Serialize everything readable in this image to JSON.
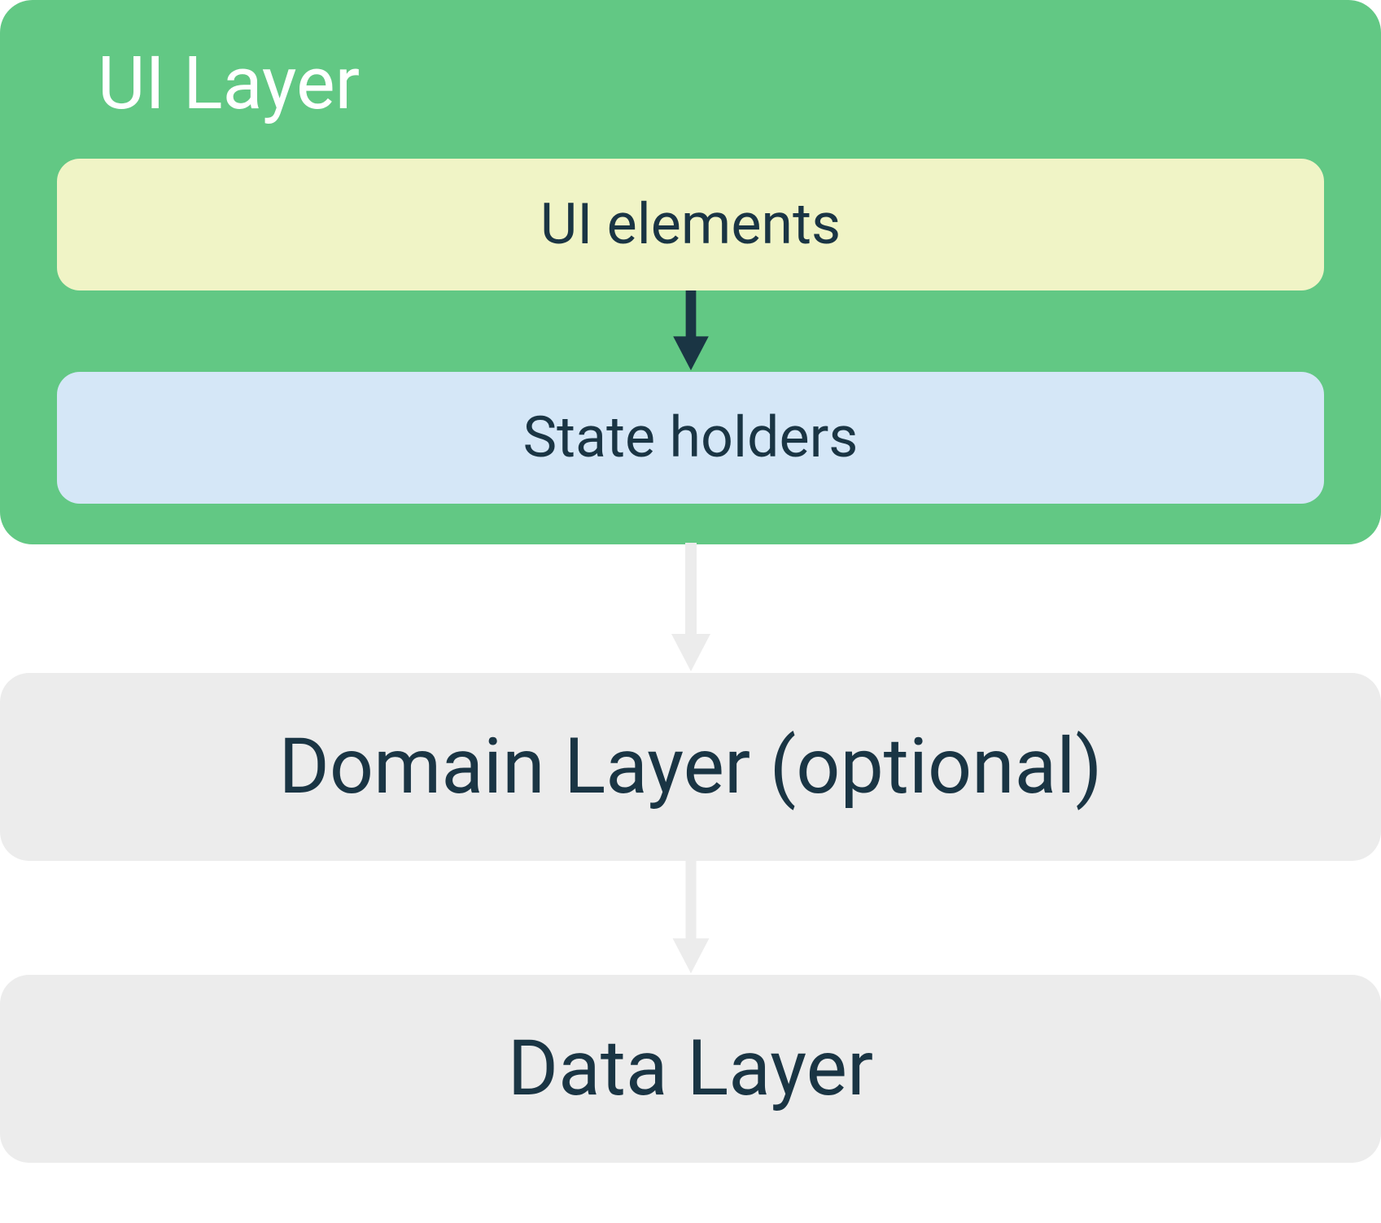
{
  "ui_layer": {
    "title": "UI Layer",
    "ui_elements_label": "UI elements",
    "state_holders_label": "State holders"
  },
  "domain_layer": {
    "label": "Domain Layer (optional)"
  },
  "data_layer": {
    "label": "Data Layer"
  },
  "colors": {
    "ui_layer_bg": "#62c884",
    "ui_elements_bg": "#f0f4c6",
    "state_holders_bg": "#d5e7f7",
    "outer_box_bg": "#ececec",
    "text_dark": "#1a3544",
    "text_white": "#ffffff",
    "arrow_dark": "#1a3544",
    "arrow_light": "#ececec"
  }
}
